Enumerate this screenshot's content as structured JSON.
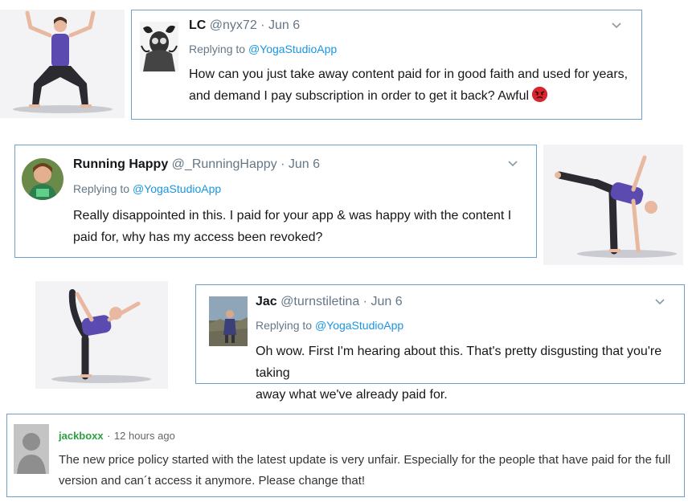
{
  "tweets": [
    {
      "name": "LC",
      "handle": "@nyx72",
      "date": "Jun 6",
      "replying_prefix": "Replying to",
      "replying_handle": "@YogaStudioApp",
      "text_line1": "How can you just take away content paid for in good faith and used for years,",
      "text_line2": "and demand I pay subscription in order to get it back? Awful",
      "emoji": "angry-face-emoji"
    },
    {
      "name": "Running Happy",
      "handle": "@_RunningHappy",
      "date": "Jun 6",
      "replying_prefix": "Replying to",
      "replying_handle": "@YogaStudioApp",
      "text_line1": "Really disappointed in this. I paid for your app & was happy with the content I",
      "text_line2": "paid for, why has my access been revoked?"
    },
    {
      "name": "Jac",
      "handle": "@turnstiletina",
      "date": "Jun 6",
      "replying_prefix": "Replying to",
      "replying_handle": "@YogaStudioApp",
      "text_line1": "Oh wow. First I'm hearing about this. That's pretty disgusting that you're taking",
      "text_line2": "away what we've already paid for."
    }
  ],
  "review": {
    "username": "jackboxx",
    "time": "12 hours ago",
    "text_line1": "The new price policy started with the latest update is very unfair. Especially for the people that have paid for the full",
    "text_line2": "version and can´t access it anymore. Please change that!"
  },
  "colors": {
    "card_border": "#6a9fd0",
    "link_blue": "#1b95e0",
    "reviewer_green": "#2ea043",
    "outfit_purple": "#5b4bb0"
  }
}
